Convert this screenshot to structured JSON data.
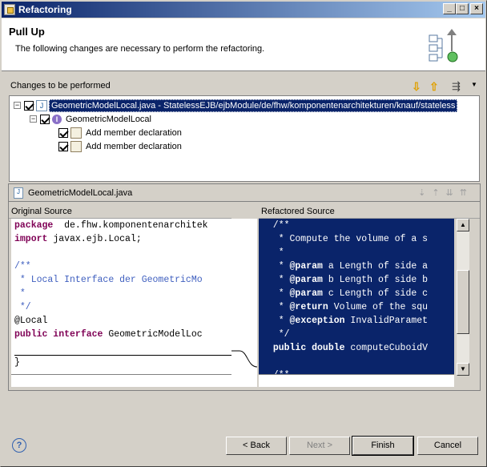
{
  "window": {
    "title": "Refactoring",
    "controls": {
      "minimize": "_",
      "maximize": "□",
      "close": "×"
    }
  },
  "header": {
    "title": "Pull Up",
    "description": "The following changes are necessary to perform the refactoring.",
    "icon": "pull-up-refactoring-icon"
  },
  "changes": {
    "label": "Changes to be performed",
    "toolbar": [
      "next-change-icon",
      "previous-change-icon",
      "filter-icon",
      "view-menu-icon"
    ],
    "tree": [
      {
        "label": "GeometricModelLocal.java - StatelessEJB/ejbModule/de/fhw/komponentenarchitekturen/knauf/stateless",
        "checked": true,
        "expanded": true,
        "selected": true,
        "level": 0,
        "icon": "java-file-icon"
      },
      {
        "label": "GeometricModelLocal",
        "checked": true,
        "expanded": true,
        "level": 1,
        "icon": "interface-icon"
      },
      {
        "label": "Add member declaration",
        "checked": true,
        "level": 2,
        "icon": "change-icon"
      },
      {
        "label": "Add member declaration",
        "checked": true,
        "level": 2,
        "icon": "change-icon"
      }
    ]
  },
  "compare": {
    "file": "GeometricModelLocal.java",
    "left_title": "Original Source",
    "right_title": "Refactored Source",
    "left_lines": [
      [
        [
          "kw",
          "package"
        ],
        [
          "",
          "  de.fhw.komponentenarchitek"
        ]
      ],
      [
        [
          "kw",
          "import"
        ],
        [
          "",
          " javax.ejb.Local;"
        ]
      ],
      [
        [
          "",
          ""
        ]
      ],
      [
        [
          "cm",
          "/**"
        ]
      ],
      [
        [
          "cm",
          " * Local Interface der GeometricMo"
        ]
      ],
      [
        [
          "cm",
          " *"
        ]
      ],
      [
        [
          "cm",
          " */"
        ]
      ],
      [
        [
          "",
          "@Local"
        ]
      ],
      [
        [
          "kw",
          "public interface"
        ],
        [
          "",
          " GeometricModelLoc"
        ]
      ],
      [
        [
          "",
          ""
        ]
      ],
      [
        [
          "",
          "}"
        ]
      ]
    ],
    "right_lines": [
      "  /**",
      "   * Compute the volume of a s",
      "   *",
      "   * @param a Length of side a",
      "   * @param b Length of side b",
      "   * @param c Length of side c",
      "   * @return Volume of the squ",
      "   * @exception InvalidParamet",
      "   */",
      "  public double computeCuboidV",
      "",
      "  /**"
    ]
  },
  "buttons": {
    "help": "?",
    "back": "< Back",
    "next": "Next >",
    "finish": "Finish",
    "cancel": "Cancel"
  }
}
